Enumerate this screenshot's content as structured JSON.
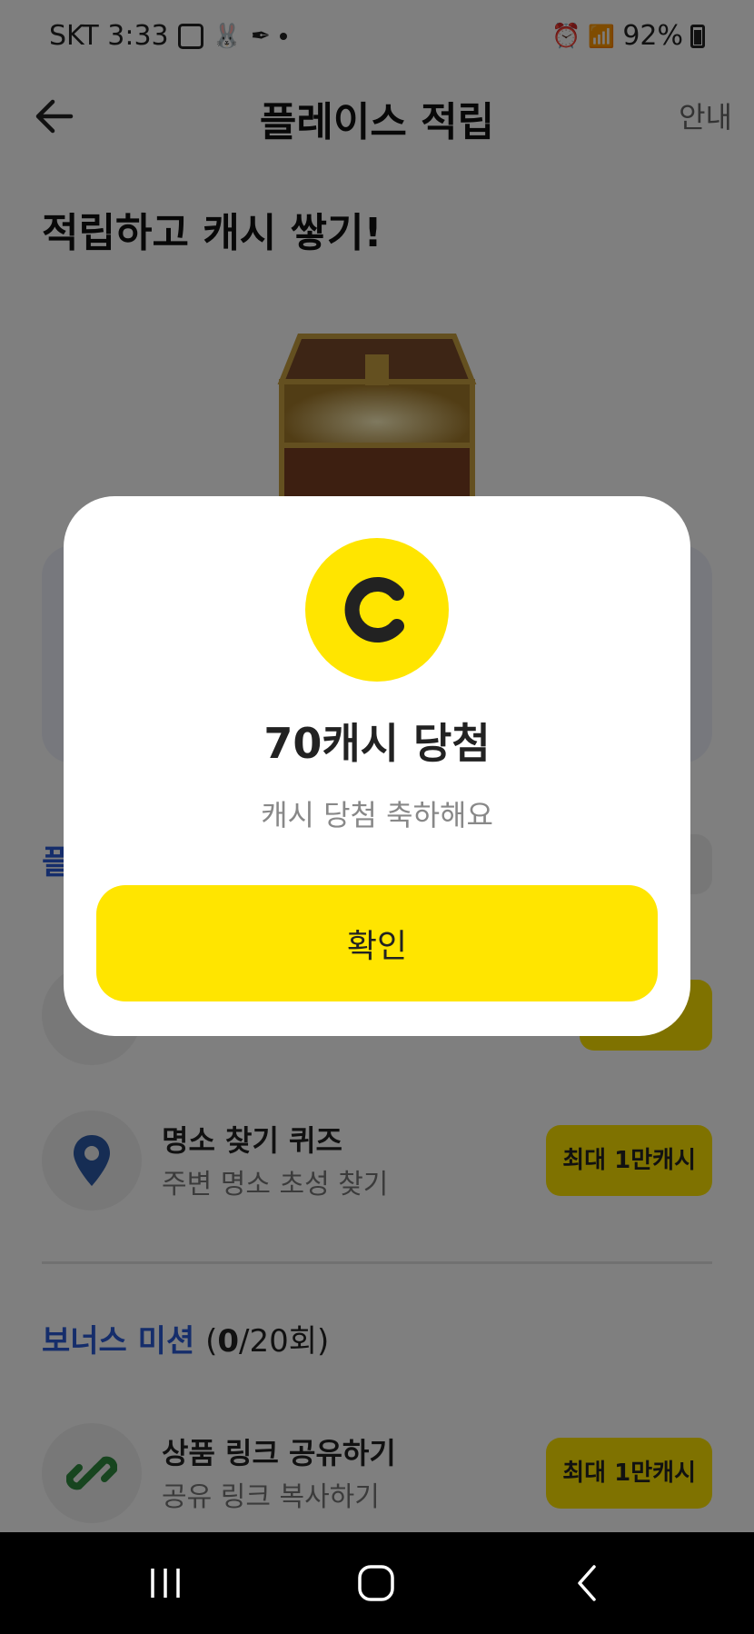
{
  "status_bar": {
    "carrier_time": "SKT 3:33",
    "battery": "92%"
  },
  "header": {
    "title": "플레이스 적립",
    "guide": "안내"
  },
  "hero": {
    "title": "적립하고 캐시 쌓기!"
  },
  "section": {
    "partial_label": "플"
  },
  "missions": [
    {
      "title": "명소 찾기 퀴즈",
      "subtitle": "주변 명소 초성 찾기",
      "reward": "최대 1만캐시",
      "icon": "location-pin-icon"
    }
  ],
  "bonus": {
    "title": "보너스 미션",
    "count_done": "0",
    "count_total": "/20회)",
    "count_open": "("
  },
  "bonus_missions": [
    {
      "title": "상품 링크 공유하기",
      "subtitle": "공유 링크 복사하기",
      "reward": "최대 1만캐시",
      "icon": "link-icon"
    }
  ],
  "modal": {
    "coin_letter": "C",
    "title": "70캐시 당첨",
    "subtitle": "캐시 당첨 축하해요",
    "confirm_label": "확인"
  },
  "colors": {
    "accent_yellow": "#ffe500",
    "accent_blue": "#2a5bd7",
    "pin_blue": "#2c5aa8",
    "link_green": "#2e8b3e"
  }
}
